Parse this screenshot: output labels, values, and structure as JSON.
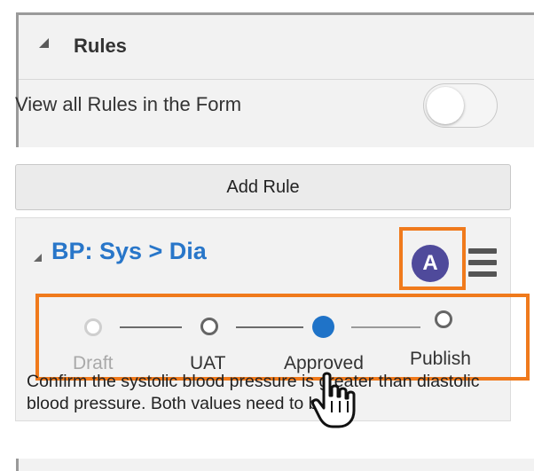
{
  "section": {
    "title": "Rules",
    "collapse_icon": "collapse-triangle-icon"
  },
  "view_all": {
    "label": "View all Rules in the Form",
    "toggle_on": false
  },
  "add_rule": {
    "label": "Add Rule"
  },
  "rule": {
    "title": "BP: Sys > Dia",
    "avatar_letter": "A",
    "avatar_color": "#4f4a9b",
    "menu_icon": "hamburger-menu-icon",
    "steps": [
      {
        "label": "Draft",
        "state": "disabled"
      },
      {
        "label": "UAT",
        "state": "default"
      },
      {
        "label": "Approved",
        "state": "active"
      },
      {
        "label": "Publish",
        "state": "default"
      }
    ],
    "description": "Confirm the systolic blood pressure is greater than diastolic blood pressure. Both values need to b..."
  },
  "colors": {
    "accent": "#2876c9",
    "highlight": "#f07a1c",
    "active_step": "#1f73c8"
  }
}
